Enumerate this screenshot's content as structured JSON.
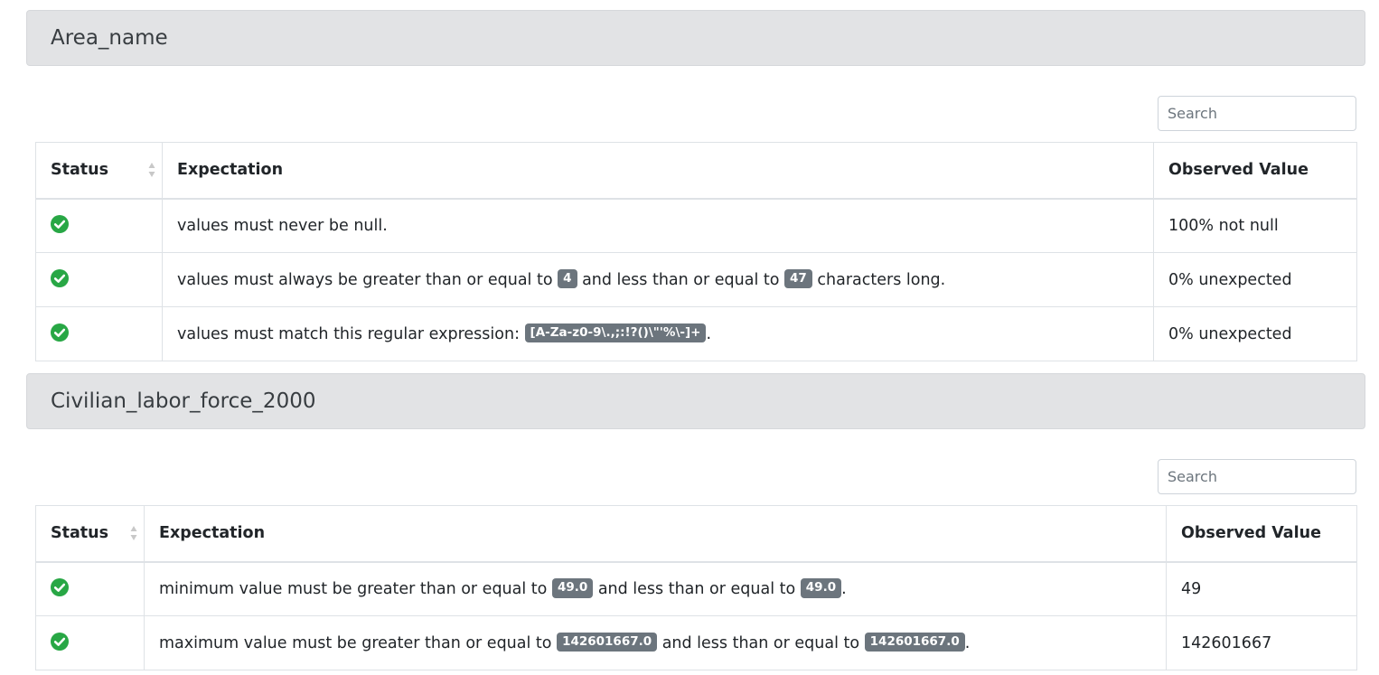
{
  "sections": [
    {
      "title": "Area_name",
      "search_placeholder": "Search",
      "headers": {
        "status": "Status",
        "expectation": "Expectation",
        "observed": "Observed Value"
      },
      "rows": [
        {
          "status": "success",
          "parts": [
            "values must never be null."
          ],
          "badges": [],
          "observed": "100% not null"
        },
        {
          "status": "success",
          "parts": [
            "values must always be greater than or equal to ",
            " and less than or equal to ",
            " characters long."
          ],
          "badges": [
            "4",
            "47"
          ],
          "observed": "0% unexpected"
        },
        {
          "status": "success",
          "parts": [
            "values must match this regular expression: ",
            "."
          ],
          "badges": [
            "[A-Za-z0-9\\.,;:!?()\\\"'%\\-]+"
          ],
          "observed": "0% unexpected"
        }
      ]
    },
    {
      "title": "Civilian_labor_force_2000",
      "search_placeholder": "Search",
      "headers": {
        "status": "Status",
        "expectation": "Expectation",
        "observed": "Observed Value"
      },
      "rows": [
        {
          "status": "success",
          "parts": [
            "minimum value must be greater than or equal to ",
            " and less than or equal to ",
            "."
          ],
          "badges": [
            "49.0",
            "49.0"
          ],
          "observed": "49"
        },
        {
          "status": "success",
          "parts": [
            "maximum value must be greater than or equal to ",
            " and less than or equal to ",
            "."
          ],
          "badges": [
            "142601667.0",
            "142601667.0"
          ],
          "observed": "142601667"
        }
      ]
    }
  ],
  "colors": {
    "success": "#28a745",
    "badge": "#6c757d",
    "header_bg": "#e2e3e5"
  },
  "icons": {
    "status_success": "check-circle-icon",
    "sort": "sort-icon"
  }
}
